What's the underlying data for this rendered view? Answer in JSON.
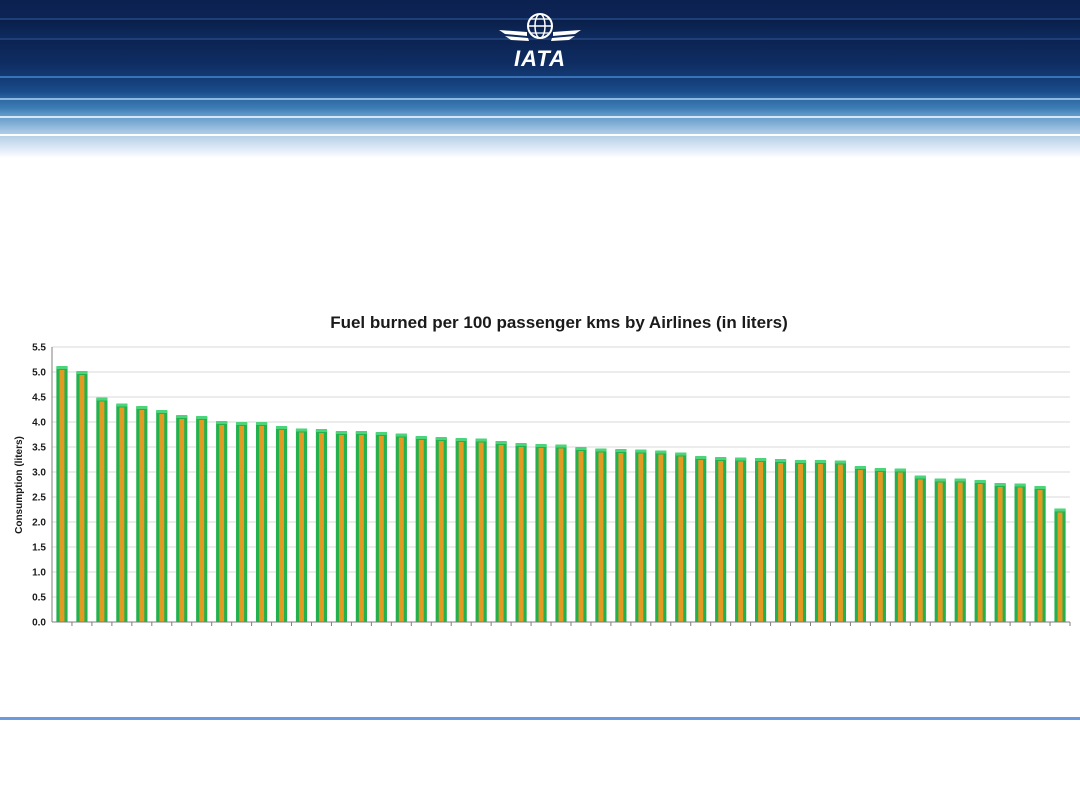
{
  "logo": {
    "text": "IATA",
    "icon": "globe-wings-icon"
  },
  "colors": {
    "header_dark": "#0b2150",
    "bar_fill": "#e39a22",
    "bar_edge": "#22b14c",
    "footer_line": "#6a9be0"
  },
  "chart_data": {
    "type": "bar",
    "title": "Fuel burned per 100 passenger kms by Airlines (in liters)",
    "xlabel": "",
    "ylabel": "Consumption (liters)",
    "ylim": [
      0,
      5.5
    ],
    "yticks": [
      "0.0",
      "0.5",
      "1.0",
      "1.5",
      "2.0",
      "2.5",
      "3.0",
      "3.5",
      "4.0",
      "4.5",
      "5.0",
      "5.5"
    ],
    "grid": true,
    "values": [
      5.1,
      5.0,
      4.47,
      4.35,
      4.3,
      4.22,
      4.12,
      4.1,
      4.0,
      3.98,
      3.98,
      3.9,
      3.85,
      3.84,
      3.8,
      3.8,
      3.78,
      3.75,
      3.7,
      3.68,
      3.66,
      3.65,
      3.6,
      3.56,
      3.54,
      3.53,
      3.48,
      3.45,
      3.44,
      3.43,
      3.41,
      3.37,
      3.3,
      3.28,
      3.27,
      3.26,
      3.24,
      3.22,
      3.22,
      3.21,
      3.1,
      3.06,
      3.05,
      2.91,
      2.85,
      2.85,
      2.82,
      2.76,
      2.75,
      2.7,
      2.25
    ]
  }
}
